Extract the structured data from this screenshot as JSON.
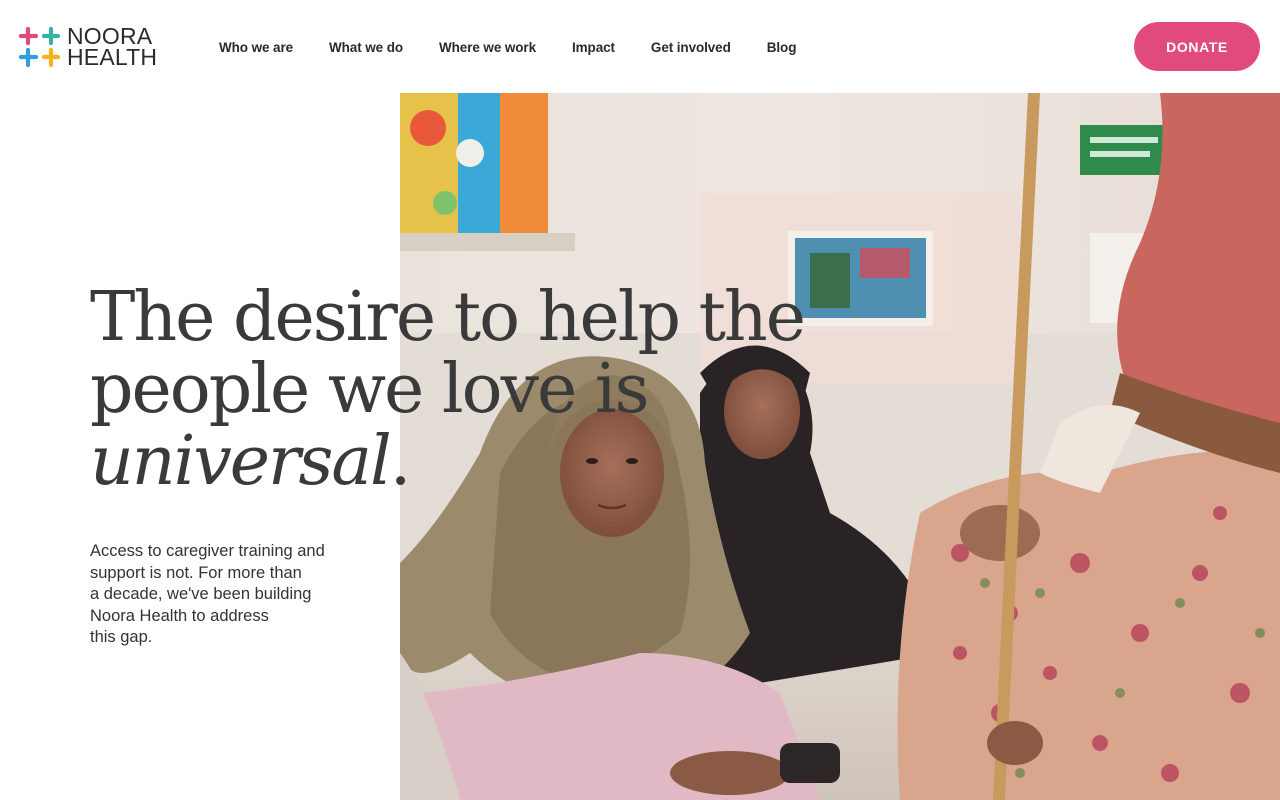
{
  "brand": {
    "name_line1": "NOORA",
    "name_line2": "HEALTH",
    "logo_icon": "plus-cluster-logo",
    "colors": {
      "pink": "#e14b7c",
      "yellow": "#f4b41a",
      "blue": "#2f9fd9",
      "teal": "#35b4a6"
    }
  },
  "nav": {
    "items": [
      {
        "label": "Who we are"
      },
      {
        "label": "What we do"
      },
      {
        "label": "Where we work"
      },
      {
        "label": "Impact"
      },
      {
        "label": "Get involved"
      },
      {
        "label": "Blog"
      }
    ]
  },
  "donate": {
    "label": "DONATE",
    "color": "#e14b7c"
  },
  "hero": {
    "headline_line1": "The desire to help the",
    "headline_line2": "people we love is",
    "headline_line3_italic": "universal",
    "headline_line3_end": ".",
    "intro_lines": [
      "Access to caregiver training and",
      "support is not. For more than",
      "a decade, we've been building",
      "Noora Health to address",
      "this gap."
    ]
  }
}
